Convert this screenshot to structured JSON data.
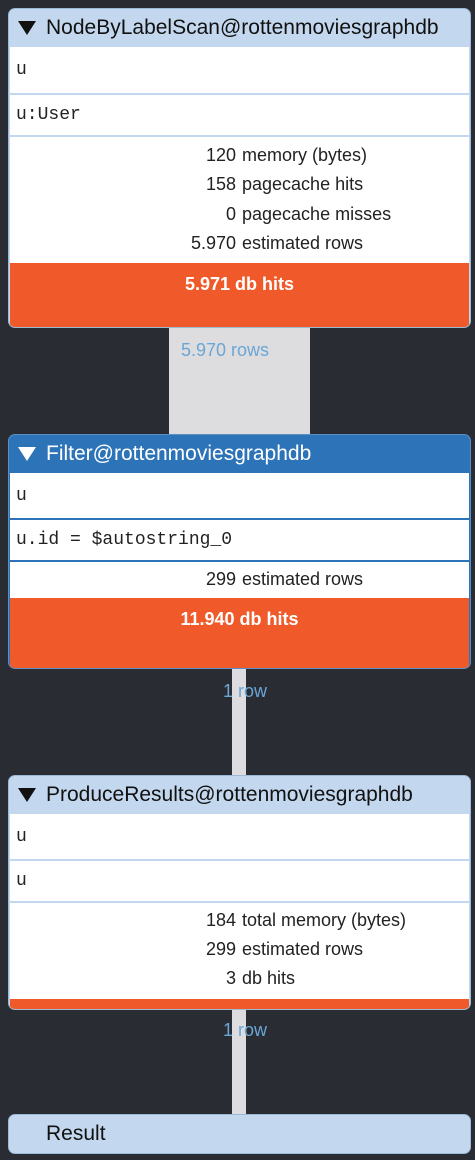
{
  "operators": [
    {
      "name": "NodeByLabelScan@rottenmoviesgraphdb",
      "details": [
        "u",
        "u:User"
      ],
      "stats": [
        {
          "value": "120",
          "label": "memory (bytes)"
        },
        {
          "value": "158",
          "label": "pagecache hits"
        },
        {
          "value": "0",
          "label": "pagecache misses"
        },
        {
          "value": "5.970",
          "label": "estimated rows"
        }
      ],
      "db_hits": "5.971 db hits"
    },
    {
      "name": "Filter@rottenmoviesgraphdb",
      "details": [
        "u",
        "u.id = $autostring_0"
      ],
      "stats": [
        {
          "value": "299",
          "label": "estimated rows"
        }
      ],
      "db_hits": "11.940 db hits"
    },
    {
      "name": "ProduceResults@rottenmoviesgraphdb",
      "details": [
        "u",
        "u"
      ],
      "stats": [
        {
          "value": "184",
          "label": "total memory (bytes)"
        },
        {
          "value": "299",
          "label": "estimated rows"
        },
        {
          "value": "3",
          "label": "db hits"
        }
      ]
    },
    {
      "name": "Result"
    }
  ],
  "connectors": [
    {
      "label": "5.970 rows"
    },
    {
      "label": "1 row"
    },
    {
      "label": "1 row"
    }
  ],
  "colors": {
    "background": "#292c33",
    "header_light": "#c3d8ee",
    "header_selected": "#2d73b8",
    "db_hits": "#f05a2a",
    "connector": "#dddddf",
    "connector_label": "#6aa6d6"
  }
}
